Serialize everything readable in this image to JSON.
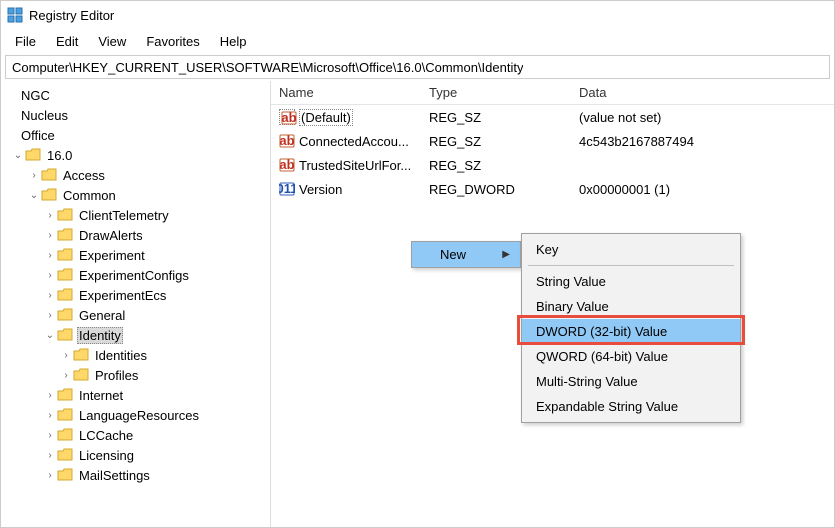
{
  "window": {
    "title": "Registry Editor"
  },
  "menu": [
    "File",
    "Edit",
    "View",
    "Favorites",
    "Help"
  ],
  "address": "Computer\\HKEY_CURRENT_USER\\SOFTWARE\\Microsoft\\Office\\16.0\\Common\\Identity",
  "tree_flat": [
    {
      "label": "NGC",
      "depth": 0,
      "chev": "",
      "hasFolder": false
    },
    {
      "label": "Nucleus",
      "depth": 0,
      "chev": "",
      "hasFolder": false
    },
    {
      "label": "Office",
      "depth": 0,
      "chev": "",
      "hasFolder": false
    },
    {
      "label": "16.0",
      "depth": 1,
      "chev": "v",
      "hasFolder": true
    },
    {
      "label": "Access",
      "depth": 2,
      "chev": ">",
      "hasFolder": true
    },
    {
      "label": "Common",
      "depth": 2,
      "chev": "v",
      "hasFolder": true
    },
    {
      "label": "ClientTelemetry",
      "depth": 3,
      "chev": ">",
      "hasFolder": true
    },
    {
      "label": "DrawAlerts",
      "depth": 3,
      "chev": ">",
      "hasFolder": true
    },
    {
      "label": "Experiment",
      "depth": 3,
      "chev": ">",
      "hasFolder": true
    },
    {
      "label": "ExperimentConfigs",
      "depth": 3,
      "chev": ">",
      "hasFolder": true
    },
    {
      "label": "ExperimentEcs",
      "depth": 3,
      "chev": ">",
      "hasFolder": true
    },
    {
      "label": "General",
      "depth": 3,
      "chev": ">",
      "hasFolder": true
    },
    {
      "label": "Identity",
      "depth": 3,
      "chev": "v",
      "hasFolder": true,
      "selected": true
    },
    {
      "label": "Identities",
      "depth": 4,
      "chev": ">",
      "hasFolder": true
    },
    {
      "label": "Profiles",
      "depth": 4,
      "chev": ">",
      "hasFolder": true
    },
    {
      "label": "Internet",
      "depth": 3,
      "chev": ">",
      "hasFolder": true
    },
    {
      "label": "LanguageResources",
      "depth": 3,
      "chev": ">",
      "hasFolder": true
    },
    {
      "label": "LCCache",
      "depth": 3,
      "chev": ">",
      "hasFolder": true
    },
    {
      "label": "Licensing",
      "depth": 3,
      "chev": ">",
      "hasFolder": true
    },
    {
      "label": "MailSettings",
      "depth": 3,
      "chev": ">",
      "hasFolder": true
    }
  ],
  "columns": {
    "name": "Name",
    "type": "Type",
    "data": "Data"
  },
  "values": [
    {
      "name": "(Default)",
      "type": "REG_SZ",
      "data": "(value not set)",
      "kind": "sz",
      "focused": true
    },
    {
      "name": "ConnectedAccou...",
      "type": "REG_SZ",
      "data": "4c543b2167887494",
      "kind": "sz"
    },
    {
      "name": "TrustedSiteUrlFor...",
      "type": "REG_SZ",
      "data": "",
      "kind": "sz"
    },
    {
      "name": "Version",
      "type": "REG_DWORD",
      "data": "0x00000001 (1)",
      "kind": "dw"
    }
  ],
  "context": {
    "parent_item": "New",
    "sub_items": [
      {
        "label": "Key",
        "sep_after": true
      },
      {
        "label": "String Value"
      },
      {
        "label": "Binary Value"
      },
      {
        "label": "DWORD (32-bit) Value",
        "highlighted": true
      },
      {
        "label": "QWORD (64-bit) Value"
      },
      {
        "label": "Multi-String Value"
      },
      {
        "label": "Expandable String Value"
      }
    ]
  }
}
